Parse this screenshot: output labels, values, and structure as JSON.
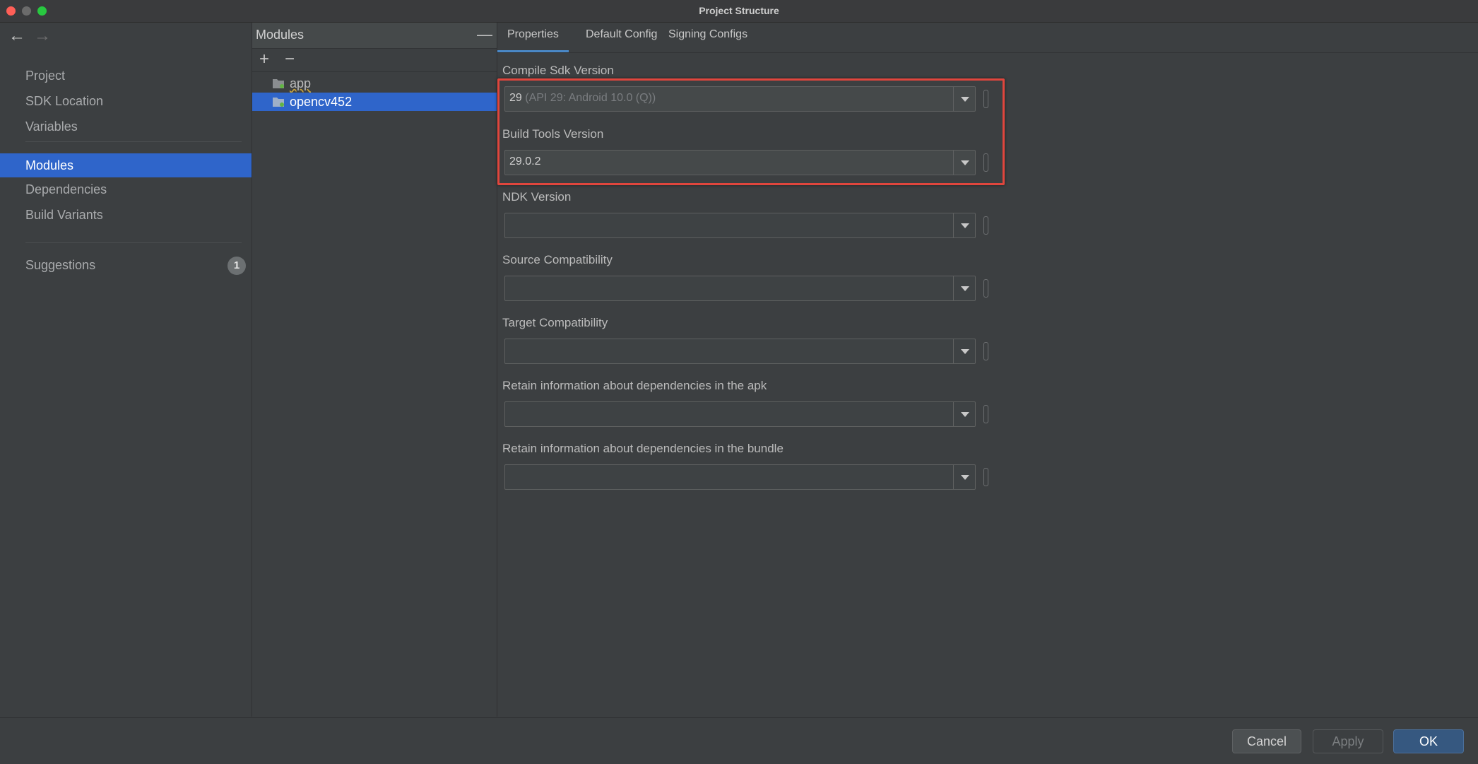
{
  "window": {
    "title": "Project Structure"
  },
  "nav": {
    "back_icon": "←",
    "forward_icon": "→",
    "items": [
      {
        "label": "Project"
      },
      {
        "label": "SDK Location"
      },
      {
        "label": "Variables"
      },
      {
        "label": "Modules"
      },
      {
        "label": "Dependencies"
      },
      {
        "label": "Build Variants"
      },
      {
        "label": "Suggestions",
        "badge": "1"
      }
    ],
    "active": "Modules"
  },
  "modules": {
    "title": "Modules",
    "collapse_icon": "—",
    "add_icon": "+",
    "remove_icon": "−",
    "items": [
      {
        "label": "app"
      },
      {
        "label": "opencv452"
      }
    ],
    "selected": "opencv452"
  },
  "tabs": [
    {
      "label": "Properties"
    },
    {
      "label": "Default Config"
    },
    {
      "label": "Signing Configs"
    }
  ],
  "active_tab": "Properties",
  "fields": [
    {
      "label": "Compile Sdk Version",
      "value": "29",
      "value_suffix": " (API 29: Android 10.0 (Q))"
    },
    {
      "label": "Build Tools Version",
      "value": "29.0.2"
    },
    {
      "label": "NDK Version",
      "value": ""
    },
    {
      "label": "Source Compatibility",
      "value": ""
    },
    {
      "label": "Target Compatibility",
      "value": ""
    },
    {
      "label": "Retain information about dependencies in the apk",
      "value": ""
    },
    {
      "label": "Retain information about dependencies in the bundle",
      "value": ""
    }
  ],
  "buttons": {
    "cancel": "Cancel",
    "apply": "Apply",
    "ok": "OK"
  },
  "colors": {
    "selection": "#2f65ca",
    "highlight_box": "#e0463d",
    "ok_button": "#365880"
  }
}
